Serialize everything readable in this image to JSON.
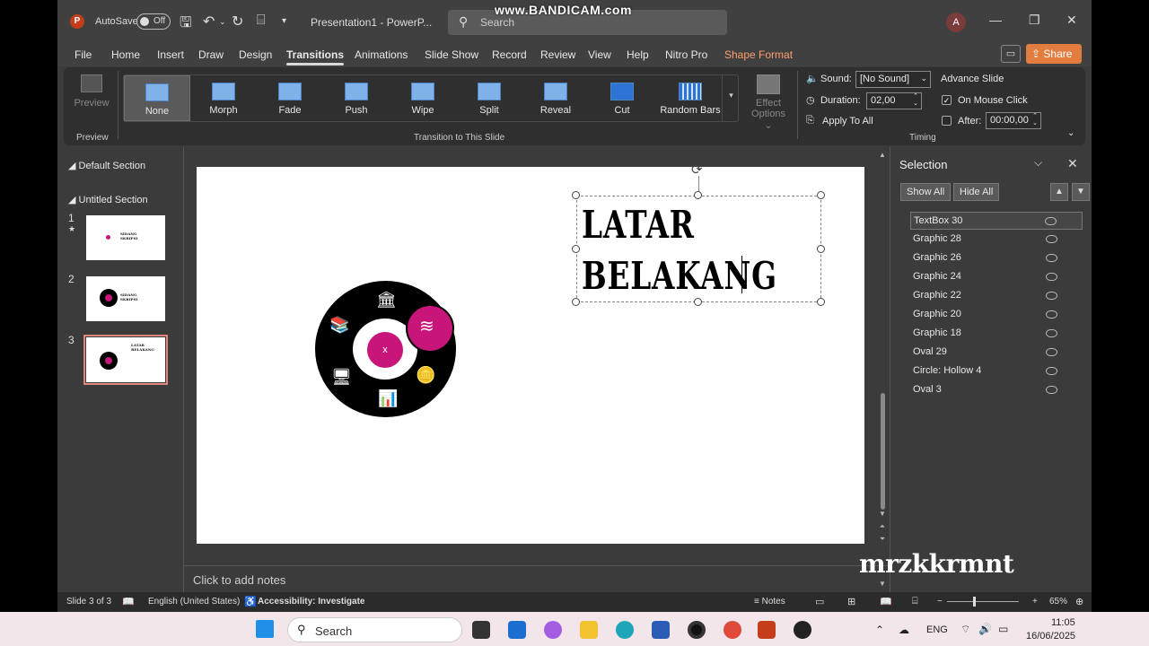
{
  "titlebar": {
    "autosave_label": "AutoSave",
    "autosave_state": "Off",
    "doc_title": "Presentation1  -  PowerP...",
    "search_placeholder": "Search",
    "avatar_initial": "A",
    "recorder_watermark": "www.BANDICAM.com"
  },
  "menu": {
    "tabs": [
      "File",
      "Home",
      "Insert",
      "Draw",
      "Design",
      "Transitions",
      "Animations",
      "Slide Show",
      "Record",
      "Review",
      "View",
      "Help",
      "Nitro Pro",
      "Shape Format"
    ],
    "active": "Transitions",
    "share_label": "Share"
  },
  "ribbon": {
    "preview_label": "Preview",
    "preview_group": "Preview",
    "gallery_group": "Transition to This Slide",
    "transitions": [
      "None",
      "Morph",
      "Fade",
      "Push",
      "Wipe",
      "Split",
      "Reveal",
      "Cut",
      "Random Bars"
    ],
    "selected_transition": "None",
    "effect_options_line1": "Effect",
    "effect_options_line2": "Options",
    "sound_label": "Sound:",
    "sound_value": "[No Sound]",
    "duration_label": "Duration:",
    "duration_value": "02,00",
    "apply_all_label": "Apply To All",
    "advance_label": "Advance Slide",
    "on_click_label": "On Mouse Click",
    "on_click_checked": true,
    "after_label": "After:",
    "after_value": "00:00,00",
    "after_checked": false,
    "timing_group": "Timing"
  },
  "thumbs": {
    "sections": [
      "Default Section",
      "Untitled Section"
    ],
    "slides": [
      {
        "num": "1",
        "star": "★",
        "title_lines": [
          "SIDANG",
          "SKRIPSI"
        ]
      },
      {
        "num": "2",
        "title_lines": [
          "SIDANG",
          "SKRIPSI"
        ]
      },
      {
        "num": "3",
        "title_lines": [
          "LATAR",
          "BELAKANG"
        ]
      }
    ]
  },
  "slide": {
    "title": "LATAR\nBELAKANG",
    "center_label": "x",
    "accent_color": "#c8157a"
  },
  "selection": {
    "title": "Selection",
    "show_all": "Show All",
    "hide_all": "Hide All",
    "items": [
      "TextBox 30",
      "Graphic 28",
      "Graphic 26",
      "Graphic 24",
      "Graphic 22",
      "Graphic 20",
      "Graphic 18",
      "Oval 29",
      "Circle: Hollow 4",
      "Oval 3"
    ],
    "active_item": "TextBox 30"
  },
  "notes": {
    "placeholder": "Click to add notes"
  },
  "overlay_text": "mrzkkrmnt",
  "status": {
    "slide_info": "Slide 3 of 3",
    "language": "English (United States)",
    "accessibility": "Accessibility: Investigate",
    "notes_label": "Notes",
    "zoom": "65%"
  },
  "taskbar": {
    "search_placeholder": "Search",
    "lang": "ENG",
    "time": "11:05",
    "date": "16/06/2025"
  }
}
